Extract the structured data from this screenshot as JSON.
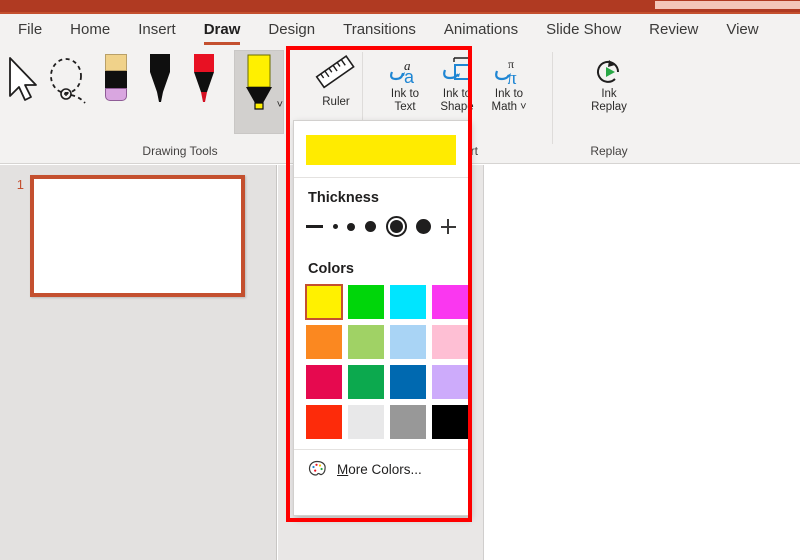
{
  "app": {
    "titlebar_color": "#b03a22",
    "accent_color": "#c4502f"
  },
  "ribbon_tabs": [
    {
      "label": "File",
      "active": false
    },
    {
      "label": "Home",
      "active": false
    },
    {
      "label": "Insert",
      "active": false
    },
    {
      "label": "Draw",
      "active": true
    },
    {
      "label": "Design",
      "active": false
    },
    {
      "label": "Transitions",
      "active": false
    },
    {
      "label": "Animations",
      "active": false
    },
    {
      "label": "Slide Show",
      "active": false
    },
    {
      "label": "Review",
      "active": false
    },
    {
      "label": "View",
      "active": false
    }
  ],
  "ribbon": {
    "groups": [
      {
        "name": "drawing_tools",
        "label": "Drawing Tools"
      },
      {
        "name": "convert",
        "label": "Convert"
      },
      {
        "name": "replay",
        "label": "Replay"
      }
    ],
    "drawing_tools": [
      {
        "name": "select",
        "icon": "cursor-arrow-icon",
        "label": ""
      },
      {
        "name": "lasso-select",
        "icon": "lasso-select-icon",
        "label": ""
      },
      {
        "name": "eraser",
        "icon": "eraser-icon",
        "label": ""
      },
      {
        "name": "pen-black",
        "icon": "pen-black-icon",
        "label": ""
      },
      {
        "name": "pen-red",
        "icon": "pen-red-icon",
        "label": ""
      },
      {
        "name": "highlighter",
        "icon": "highlighter-yellow-icon",
        "label": "",
        "selected": true
      }
    ],
    "ruler": {
      "label": "Ruler",
      "icon": "ruler-icon"
    },
    "convert_tools": [
      {
        "name": "ink-to-text",
        "line1": "Ink to",
        "line2": "Text",
        "icon": "ink-to-text-icon",
        "has_chevron": false
      },
      {
        "name": "ink-to-shape",
        "line1": "Ink to",
        "line2": "Shape",
        "icon": "ink-to-shape-icon",
        "has_chevron": false
      },
      {
        "name": "ink-to-math",
        "line1": "Ink to",
        "line2": "Math",
        "icon": "ink-to-math-icon",
        "has_chevron": true
      }
    ],
    "replay_tools": [
      {
        "name": "ink-replay",
        "line1": "Ink",
        "line2": "Replay",
        "icon": "ink-replay-icon"
      }
    ]
  },
  "highlighter_flyout": {
    "preview_color": "#ffeb00",
    "thickness": {
      "title": "Thickness",
      "decrease_icon": "minus-icon",
      "increase_icon": "plus-icon",
      "options": [
        {
          "name": "thickness-1",
          "size": 5,
          "selected": false
        },
        {
          "name": "thickness-2",
          "size": 8,
          "selected": false
        },
        {
          "name": "thickness-3",
          "size": 11,
          "selected": false
        },
        {
          "name": "thickness-4",
          "size": 13,
          "selected": true
        },
        {
          "name": "thickness-5",
          "size": 15,
          "selected": false
        }
      ]
    },
    "colors": {
      "title": "Colors",
      "swatches": [
        {
          "name": "color-yellow",
          "hex": "#fff100",
          "selected": true
        },
        {
          "name": "color-bright-green",
          "hex": "#00d60a",
          "selected": false
        },
        {
          "name": "color-cyan",
          "hex": "#00e5ff",
          "selected": false
        },
        {
          "name": "color-magenta",
          "hex": "#fa37f0",
          "selected": false
        },
        {
          "name": "color-orange",
          "hex": "#fb8820",
          "selected": false
        },
        {
          "name": "color-yellow-green",
          "hex": "#a0d265",
          "selected": false
        },
        {
          "name": "color-light-blue",
          "hex": "#a9d4f5",
          "selected": false
        },
        {
          "name": "color-pink",
          "hex": "#febfd4",
          "selected": false
        },
        {
          "name": "color-crimson",
          "hex": "#e6094f",
          "selected": false
        },
        {
          "name": "color-green",
          "hex": "#0ca94e",
          "selected": false
        },
        {
          "name": "color-blue",
          "hex": "#0069b0",
          "selected": false
        },
        {
          "name": "color-lavender",
          "hex": "#cdabfb",
          "selected": false
        },
        {
          "name": "color-red",
          "hex": "#fd2b0a",
          "selected": false
        },
        {
          "name": "color-white-smoke",
          "hex": "#e8e8e9",
          "selected": false
        },
        {
          "name": "color-gray",
          "hex": "#989898",
          "selected": false
        },
        {
          "name": "color-black",
          "hex": "#000000",
          "selected": false
        }
      ]
    },
    "more_colors": {
      "accelerator": "M",
      "rest": "ore Colors...",
      "icon": "palette-icon"
    }
  },
  "slides": {
    "items": [
      {
        "number": "1",
        "selected": true
      }
    ]
  },
  "annotation": {
    "name": "highlighter-dropdown-callout",
    "color": "#fe0000"
  }
}
